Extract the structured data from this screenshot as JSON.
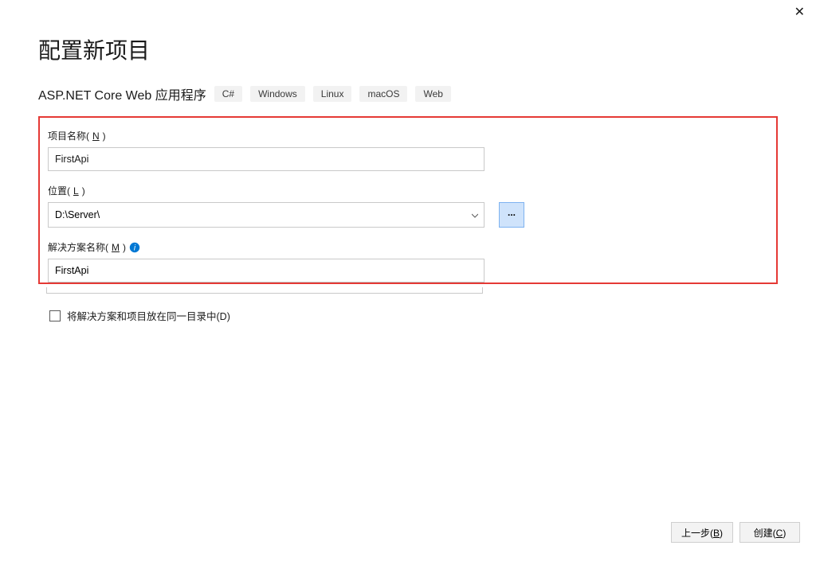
{
  "close_icon": "✕",
  "title": "配置新项目",
  "subtitle": "ASP.NET Core Web 应用程序",
  "tags": [
    "C#",
    "Windows",
    "Linux",
    "macOS",
    "Web"
  ],
  "project_name": {
    "label_prefix": "项目名称(",
    "hotkey": "N",
    "label_suffix": ")",
    "value": "FirstApi"
  },
  "location": {
    "label_prefix": "位置(",
    "hotkey": "L",
    "label_suffix": ")",
    "value": "D:\\Server\\",
    "browse_glyph": "..."
  },
  "solution_name": {
    "label_prefix": "解决方案名称(",
    "hotkey": "M",
    "label_suffix": ")",
    "value": "FirstApi"
  },
  "same_dir": {
    "label_prefix": "将解决方案和项目放在同一目录中(",
    "hotkey": "D",
    "label_suffix": ")",
    "checked": false
  },
  "footer": {
    "back_prefix": "上一步(",
    "back_hotkey": "B",
    "back_suffix": ")",
    "create_prefix": "创建(",
    "create_hotkey": "C",
    "create_suffix": ")"
  }
}
